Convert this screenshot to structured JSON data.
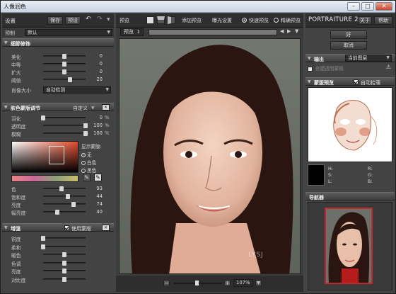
{
  "window": {
    "title": "人像润色",
    "min": "–",
    "max": "□",
    "close": "✕"
  },
  "left": {
    "tab": "设置",
    "save": "保存",
    "reset": "预设",
    "preset_label": "预制",
    "preset_value": "默认",
    "detail": {
      "title": "细節修饰",
      "rows": [
        {
          "label": "美化",
          "pos": 0.5,
          "value": "0"
        },
        {
          "label": "中等",
          "pos": 0.5,
          "value": "0"
        },
        {
          "label": "扩大",
          "pos": 0.5,
          "value": "0"
        },
        {
          "label": "阈值",
          "pos": 0.63,
          "value": "20"
        }
      ],
      "size_label": "肖像大小",
      "size_value": "自动检测"
    },
    "skin": {
      "title": "肤色蒙版调节",
      "mode": "自定义",
      "rows": [
        {
          "label": "羽化",
          "pos": 0.0,
          "value": "0",
          "unit": "%"
        },
        {
          "label": "透明度",
          "pos": 1.0,
          "value": "100",
          "unit": "%"
        },
        {
          "label": "模糊",
          "pos": 1.0,
          "value": "100",
          "unit": "%"
        }
      ],
      "show_mask": "显示蒙版:",
      "radio": [
        "无",
        "白色",
        "黑色"
      ],
      "hsl_rows": [
        {
          "label": "色",
          "pos": 0.44,
          "value": "93"
        },
        {
          "label": "饱和度",
          "pos": 0.58,
          "value": "44"
        },
        {
          "label": "亮度",
          "pos": 0.72,
          "value": "74"
        },
        {
          "label": "幅亮度",
          "pos": 0.34,
          "value": "40"
        }
      ]
    },
    "enhance": {
      "title": "增强",
      "use_mask": "使用蒙版",
      "rows": [
        {
          "label": "锐度",
          "pos": 0.0,
          "value": ""
        },
        {
          "label": "柔和",
          "pos": 0.0,
          "value": ""
        },
        {
          "label": "暖色",
          "pos": 0.5,
          "value": ""
        },
        {
          "label": "色调",
          "pos": 0.5,
          "value": ""
        },
        {
          "label": "亮度",
          "pos": 0.5,
          "value": ""
        },
        {
          "label": "对比度",
          "pos": 0.5,
          "value": ""
        }
      ]
    }
  },
  "center": {
    "preview": "预览",
    "add_preview": "添加预览",
    "exposure": "曝光设置",
    "fast_preview": "快速预览",
    "accurate_preview": "精确预览",
    "tab": "预览",
    "tab_num": "1",
    "zoom": "107%",
    "watermark": "LYSJ"
  },
  "right": {
    "brand": "PORTRAITURE 2",
    "about": "关于",
    "help": "帮助",
    "ok": "好",
    "cancel": "取消",
    "output_title": "输出",
    "output_value": "当前图层",
    "output_check": "创建透明蒙板",
    "mask_title": "蒙版预览",
    "auto_pick": "自动拾蒲",
    "hsl_labels": {
      "h": "H:",
      "s": "S:",
      "l": "L:",
      "r": "R:",
      "g": "G:",
      "b": "B:"
    },
    "nav_title": "导航器"
  },
  "colors": {
    "accent": "#c02a2a",
    "panel": "#434343",
    "dark": "#2e2e2e"
  }
}
